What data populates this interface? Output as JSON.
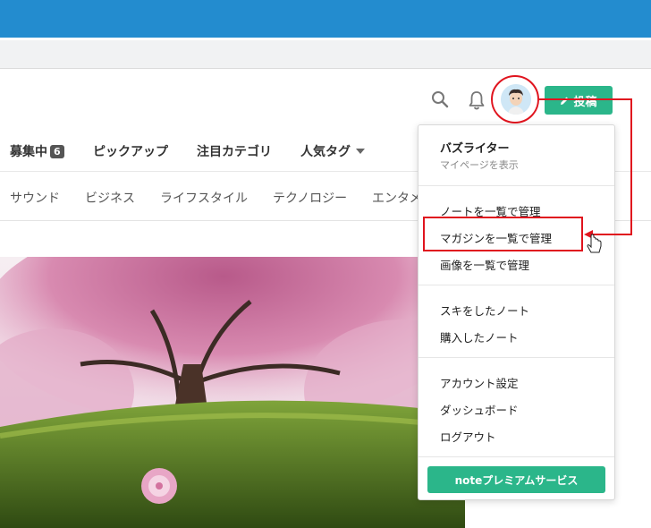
{
  "header": {
    "post_label": "投稿"
  },
  "nav_main": {
    "items": [
      {
        "label": "募集中",
        "badge": "6"
      },
      {
        "label": "ピックアップ"
      },
      {
        "label": "注目カテゴリ"
      },
      {
        "label": "人気タグ"
      }
    ]
  },
  "nav_sub": {
    "items": [
      "サウンド",
      "ビジネス",
      "ライフスタイル",
      "テクノロジー",
      "エンタメ"
    ]
  },
  "menu": {
    "user_name": "バズライター",
    "user_sub": "マイページを表示",
    "group1": [
      "ノートを一覧で管理",
      "マガジンを一覧で管理",
      "画像を一覧で管理"
    ],
    "group2": [
      "スキをしたノート",
      "購入したノート"
    ],
    "group3": [
      "アカウント設定",
      "ダッシュボード",
      "ログアウト"
    ],
    "premium_label": "noteプレミアムサービス"
  },
  "colors": {
    "topbar": "#238ccf",
    "accent_green": "#2bb68a",
    "annotation_red": "#e0141e"
  },
  "icons": [
    "search-icon",
    "bell-icon",
    "pencil-icon",
    "pointer-hand-icon",
    "caret-down-icon"
  ]
}
